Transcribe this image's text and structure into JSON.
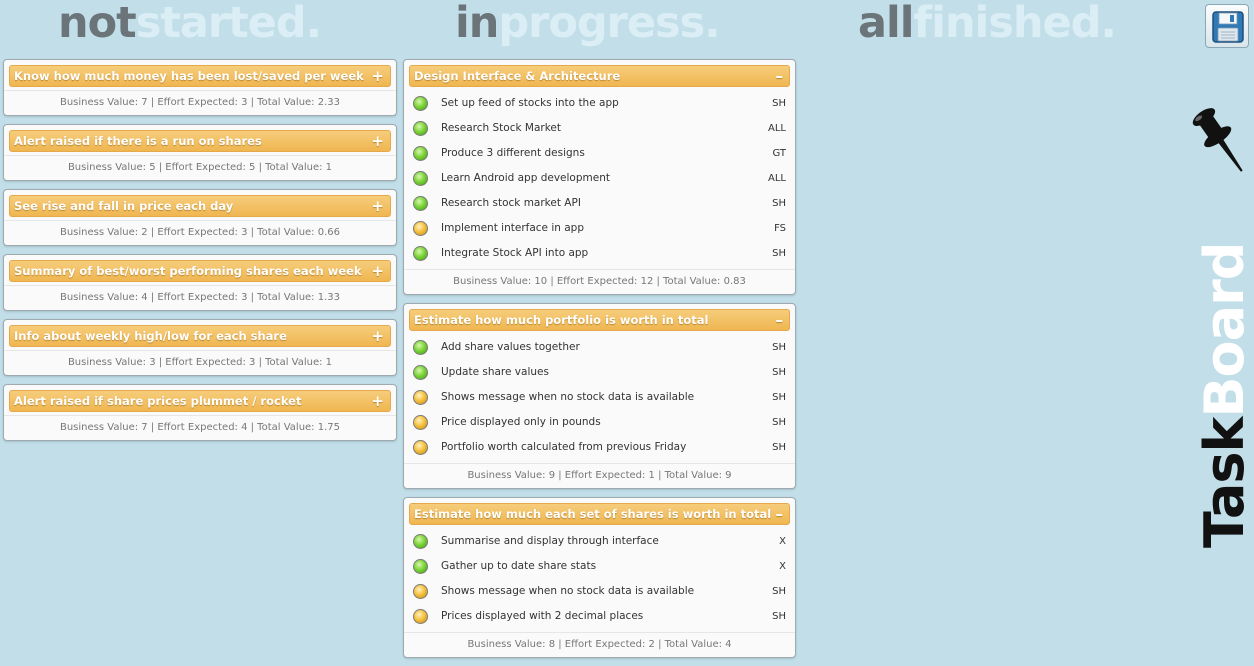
{
  "headers": {
    "not_started": {
      "dark": "not",
      "light": "started."
    },
    "in_progress": {
      "dark": "in",
      "light": "progress."
    },
    "all_finished": {
      "dark": "all",
      "light": "finished."
    }
  },
  "brand": {
    "part1": "Task",
    "part2": "Board"
  },
  "icons": {
    "save": "floppy-disk-icon",
    "pin": "push-pin-icon"
  },
  "colors": {
    "background": "#c2dfe9",
    "card_title": "#f0b955",
    "status_done": "#6cc62c",
    "status_pending": "#f2b933"
  },
  "not_started": [
    {
      "title": "Know how much money has been lost/saved per week",
      "toggle": "+",
      "stats": "Business Value: 7 | Effort Expected: 3 | Total Value: 2.33"
    },
    {
      "title": "Alert raised if there is a run on shares",
      "toggle": "+",
      "stats": "Business Value: 5 | Effort Expected: 5 | Total Value: 1"
    },
    {
      "title": "See rise and fall in price each day",
      "toggle": "+",
      "stats": "Business Value: 2 | Effort Expected: 3 | Total Value: 0.66"
    },
    {
      "title": "Summary of best/worst performing shares each week",
      "toggle": "+",
      "stats": "Business Value: 4 | Effort Expected: 3 | Total Value: 1.33"
    },
    {
      "title": "Info about weekly high/low for each share",
      "toggle": "+",
      "stats": "Business Value: 3 | Effort Expected: 3 | Total Value: 1"
    },
    {
      "title": "Alert raised if share prices plummet / rocket",
      "toggle": "+",
      "stats": "Business Value: 7 | Effort Expected: 4 | Total Value: 1.75"
    }
  ],
  "in_progress": [
    {
      "title": "Design Interface & Architecture",
      "toggle": "–",
      "tasks": [
        {
          "name": "Set up feed of stocks into the app",
          "owner": "SH",
          "status": "green"
        },
        {
          "name": "Research Stock Market",
          "owner": "ALL",
          "status": "green"
        },
        {
          "name": "Produce 3 different designs",
          "owner": "GT",
          "status": "green"
        },
        {
          "name": "Learn Android app development",
          "owner": "ALL",
          "status": "green"
        },
        {
          "name": "Research stock market API",
          "owner": "SH",
          "status": "green"
        },
        {
          "name": "Implement interface in app",
          "owner": "FS",
          "status": "yellow"
        },
        {
          "name": "Integrate Stock API into app",
          "owner": "SH",
          "status": "green"
        }
      ],
      "stats": "Business Value: 10 | Effort Expected: 12 | Total Value: 0.83"
    },
    {
      "title": "Estimate how much portfolio is worth in total",
      "toggle": "–",
      "tasks": [
        {
          "name": "Add share values together",
          "owner": "SH",
          "status": "green"
        },
        {
          "name": "Update share values",
          "owner": "SH",
          "status": "green"
        },
        {
          "name": "Shows message when no stock data is available",
          "owner": "SH",
          "status": "yellow"
        },
        {
          "name": "Price displayed only in pounds",
          "owner": "SH",
          "status": "yellow"
        },
        {
          "name": "Portfolio worth calculated from previous Friday",
          "owner": "SH",
          "status": "yellow"
        }
      ],
      "stats": "Business Value: 9 | Effort Expected: 1 | Total Value: 9"
    },
    {
      "title": "Estimate how much each set of shares is worth in total",
      "toggle": "–",
      "tasks": [
        {
          "name": "Summarise and display through interface",
          "owner": "X",
          "status": "green"
        },
        {
          "name": "Gather up to date share stats",
          "owner": "X",
          "status": "green"
        },
        {
          "name": "Shows message when no stock data is available",
          "owner": "SH",
          "status": "yellow"
        },
        {
          "name": "Prices displayed with 2 decimal places",
          "owner": "SH",
          "status": "yellow"
        }
      ],
      "stats": "Business Value: 8 | Effort Expected: 2 | Total Value: 4"
    }
  ],
  "all_finished": []
}
